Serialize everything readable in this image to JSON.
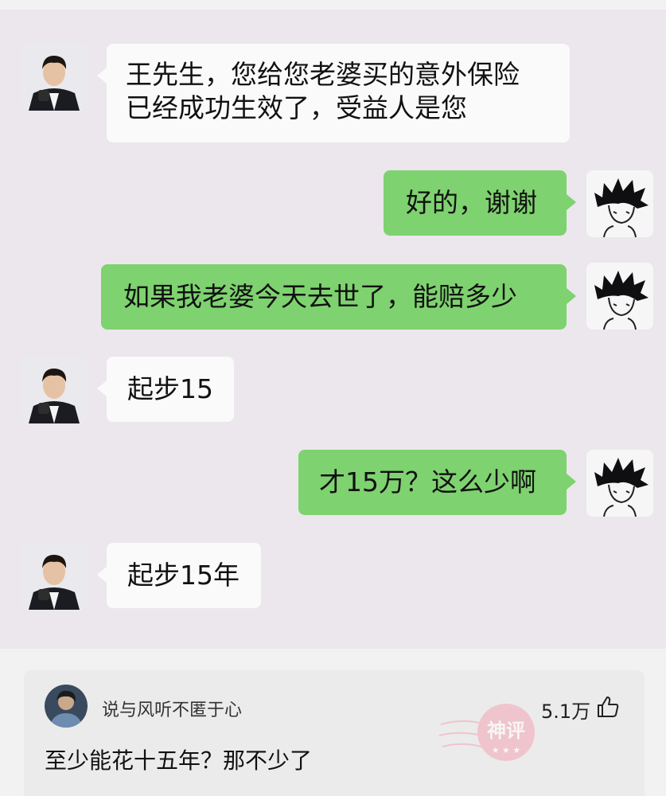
{
  "chat": {
    "messages": [
      {
        "side": "left",
        "lines": [
          "王先生，您给您老婆买的意外保险",
          "已经成功生效了，受益人是您"
        ]
      },
      {
        "side": "right",
        "lines": [
          "好的，谢谢"
        ]
      },
      {
        "side": "right",
        "lines": [
          "如果我老婆今天去世了，能赔多少"
        ]
      },
      {
        "side": "left",
        "lines": [
          "起步15"
        ]
      },
      {
        "side": "right",
        "lines": [
          "才15万？这么少啊"
        ]
      },
      {
        "side": "left",
        "lines": [
          "起步15年"
        ]
      }
    ]
  },
  "comment": {
    "username": "说与风听不匿于心",
    "likes": "5.1万",
    "text": "至少能花十五年？那不少了",
    "stamp_text": "神评",
    "thumb_icon": "thumbs-up-icon"
  },
  "colors": {
    "chat_background": "#ebe7ec",
    "bubble_left": "#fafafa",
    "bubble_right": "#7ed26f",
    "stamp": "#f3a6b6"
  }
}
